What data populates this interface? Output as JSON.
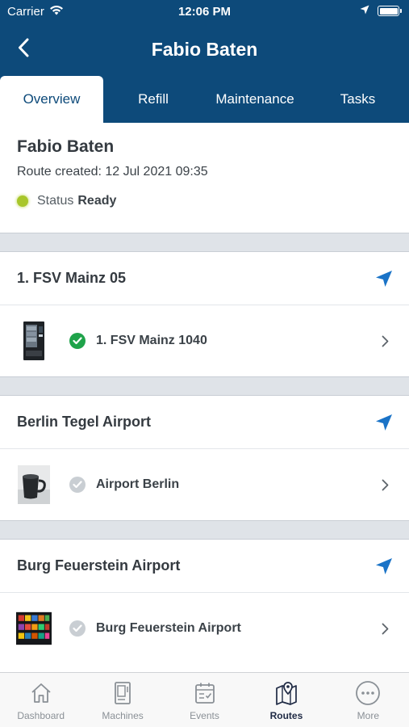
{
  "status_bar": {
    "carrier": "Carrier",
    "time": "12:06 PM"
  },
  "nav": {
    "title": "Fabio Baten"
  },
  "tabs": [
    {
      "label": "Overview",
      "active": true
    },
    {
      "label": "Refill",
      "active": false
    },
    {
      "label": "Maintenance",
      "active": false
    },
    {
      "label": "Tasks",
      "active": false
    }
  ],
  "route": {
    "name": "Fabio Baten",
    "created": "Route created: 12 Jul 2021 09:35",
    "status_label": "Status",
    "status_value": "Ready",
    "status_color": "#a8c62a"
  },
  "locations": [
    {
      "name": "1. FSV Mainz 05",
      "machine": {
        "name": "1. FSV Mainz 1040",
        "status": "done",
        "thumb": "vending-machine-photo"
      }
    },
    {
      "name": "Berlin Tegel Airport",
      "machine": {
        "name": "Airport Berlin",
        "status": "pending",
        "thumb": "coffee-mug-photo"
      }
    },
    {
      "name": "Burg Feuerstein Airport",
      "machine": {
        "name": "Burg Feuerstein Airport",
        "status": "pending",
        "thumb": "snack-machine-photo"
      }
    }
  ],
  "bottom_nav": [
    {
      "label": "Dashboard",
      "icon": "home-icon",
      "active": false
    },
    {
      "label": "Machines",
      "icon": "machine-icon",
      "active": false
    },
    {
      "label": "Events",
      "icon": "calendar-icon",
      "active": false
    },
    {
      "label": "Routes",
      "icon": "map-pin-icon",
      "active": true
    },
    {
      "label": "More",
      "icon": "more-icon",
      "active": false
    }
  ],
  "colors": {
    "header": "#0d4a7a",
    "accent_blue": "#1a73c7",
    "done_green": "#1fa34a",
    "pending_grey": "#c9ced3",
    "separator": "#dfe3e8"
  }
}
